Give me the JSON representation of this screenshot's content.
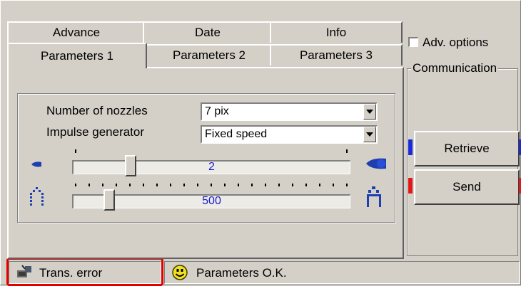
{
  "tabs": {
    "row1": [
      "Advance",
      "Date",
      "Info"
    ],
    "row2": [
      "Parameters 1",
      "Parameters 2",
      "Parameters 3"
    ],
    "active": "Parameters 1"
  },
  "params": {
    "nozzles_label": "Number of nozzles",
    "nozzles_value": "7 pix",
    "impulse_label": "Impulse generator",
    "impulse_value": "Fixed speed",
    "slider1_value": "2",
    "slider2_value": "500"
  },
  "side": {
    "adv_options_label": "Adv. options",
    "adv_options_checked": false,
    "communication_label": "Communication",
    "retrieve_label": "Retrieve",
    "send_label": "Send",
    "retrieve_accent": "#1a2ad6",
    "send_accent": "#e01818"
  },
  "status": {
    "trans_text": "Trans. error",
    "params_text": "Parameters O.K.",
    "highlight_color": "#e00000"
  },
  "icons": [
    "small-nozzle-icon",
    "large-nozzle-icon",
    "narrow-spacing-icon",
    "wide-spacing-icon",
    "transmission-icon",
    "smiley-icon"
  ]
}
